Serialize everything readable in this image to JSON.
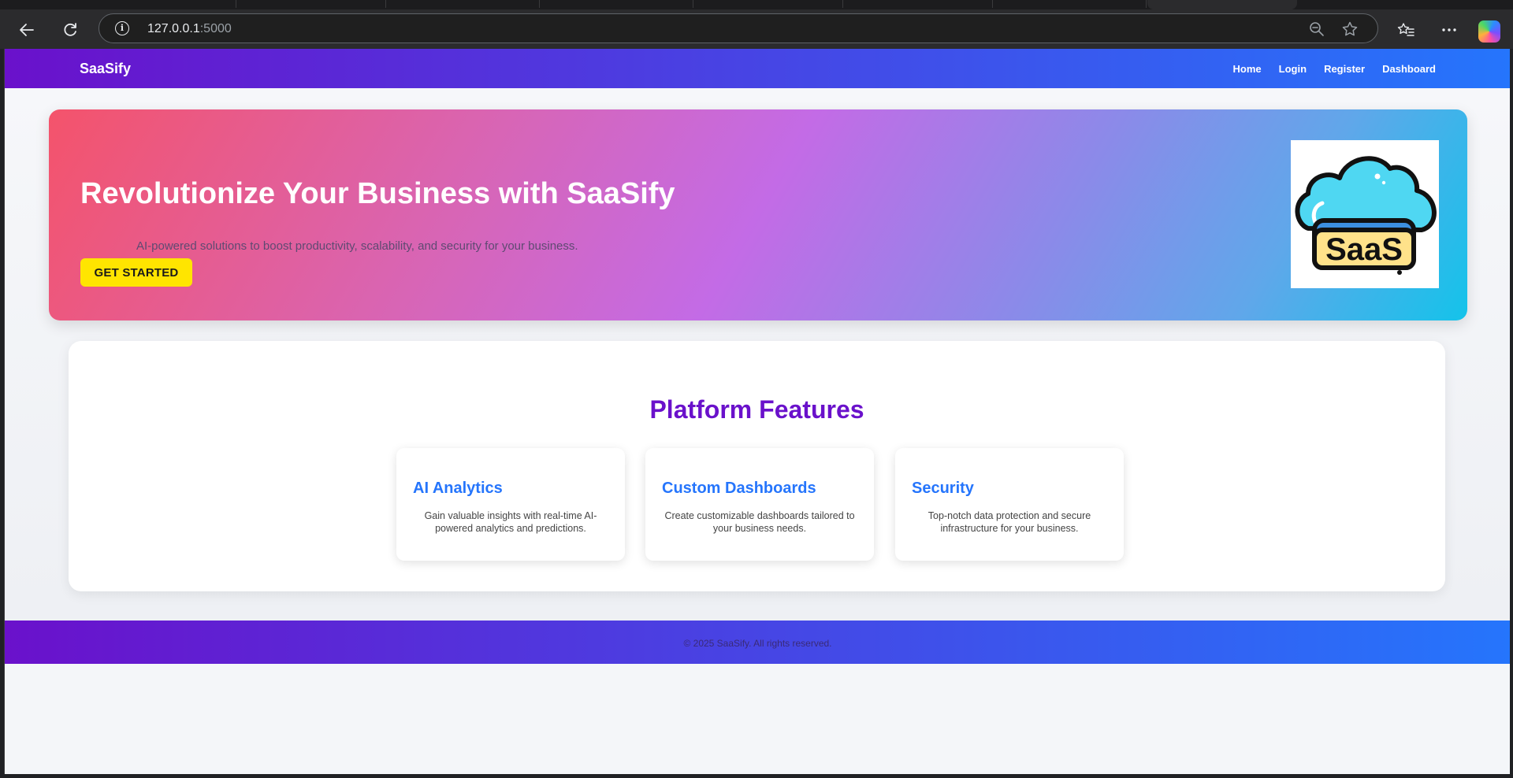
{
  "browser": {
    "url_host": "127.0.0.1",
    "url_port": ":5000"
  },
  "navbar": {
    "brand": "SaaSify",
    "links": [
      "Home",
      "Login",
      "Register",
      "Dashboard"
    ]
  },
  "hero": {
    "title": "Revolutionize Your Business with SaaSify",
    "subtitle": "AI-powered solutions to boost productivity, scalability, and security for your business.",
    "cta": "GET STARTED",
    "logo_text": "SaaS"
  },
  "features": {
    "title": "Platform Features",
    "cards": [
      {
        "title": "AI Analytics",
        "desc": "Gain valuable insights with real-time AI-powered analytics and predictions."
      },
      {
        "title": "Custom Dashboards",
        "desc": "Create customizable dashboards tailored to your business needs."
      },
      {
        "title": "Security",
        "desc": "Top-notch data protection and secure infrastructure for your business."
      }
    ]
  },
  "footer": {
    "text": "© 2025 SaaSify. All rights reserved."
  },
  "colors": {
    "brand_purple": "#6a11cb",
    "brand_blue": "#2575fc",
    "cta_yellow": "#ffe500"
  }
}
